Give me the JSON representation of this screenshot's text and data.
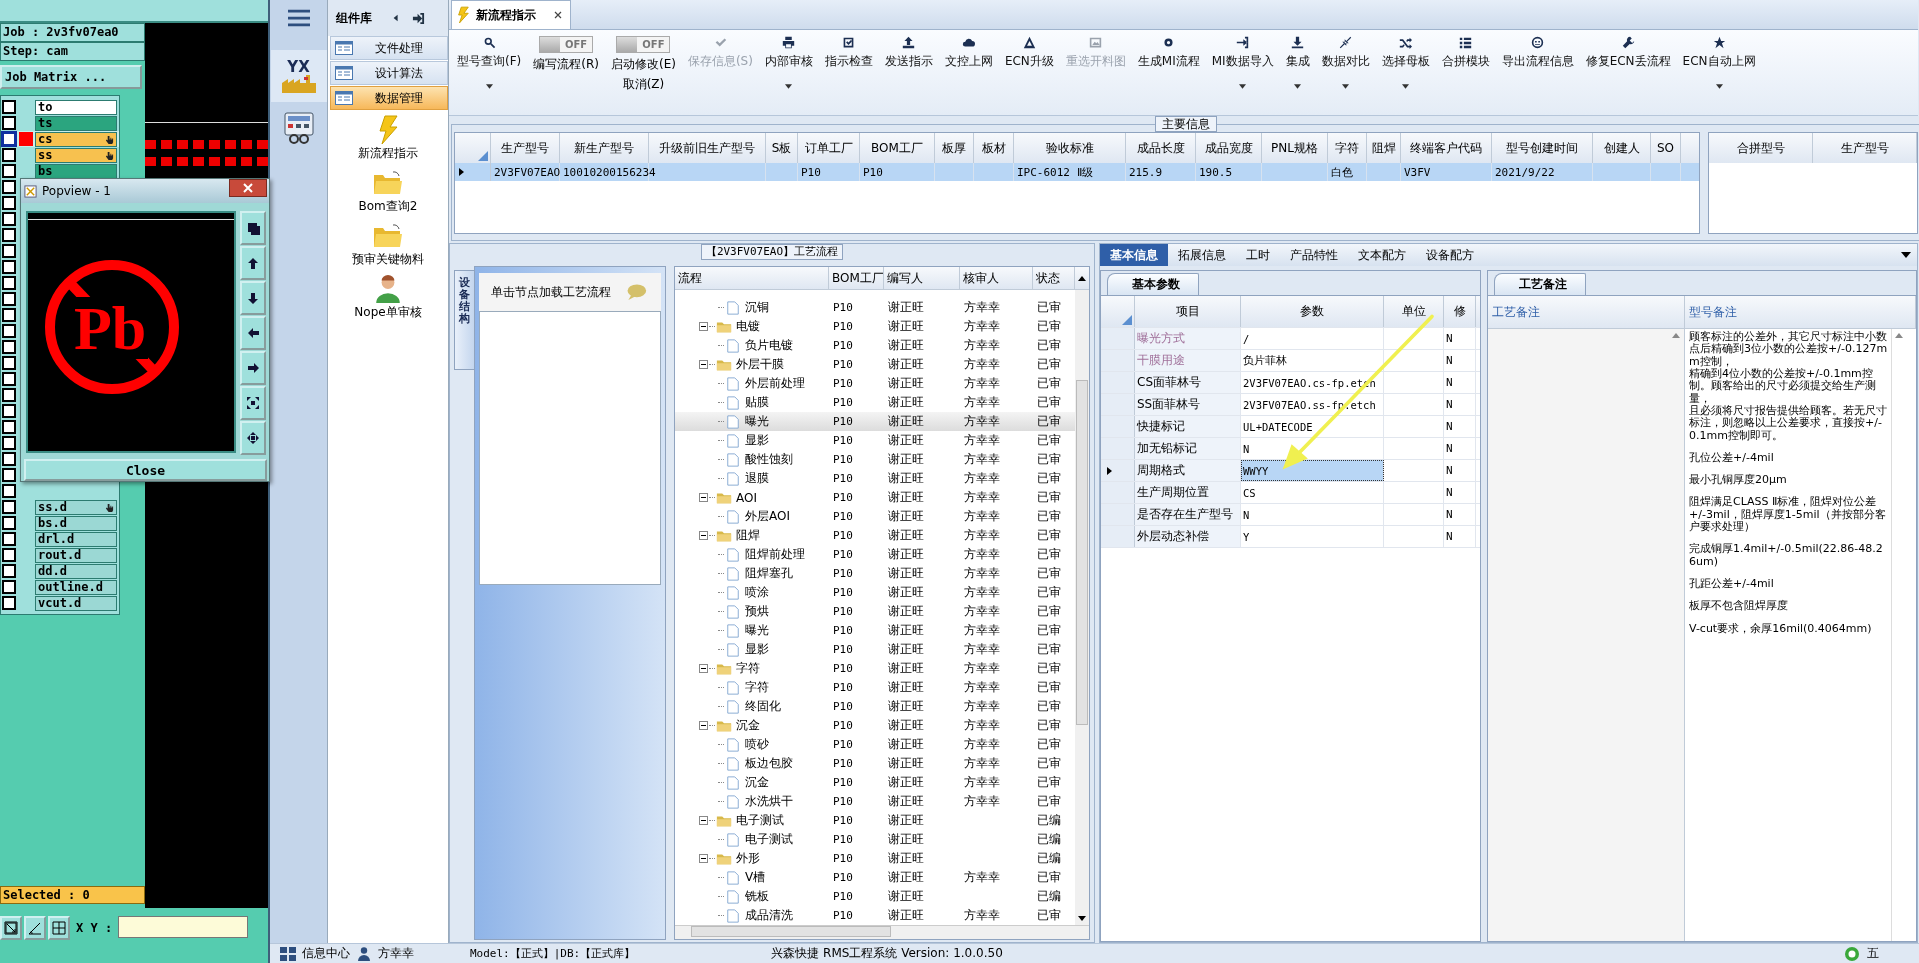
{
  "cam": {
    "job": "Job : 2v3fv07ea0",
    "step": "Step: cam",
    "matrix_button": "Job Matrix ...",
    "layers_top": [
      {
        "name": "to",
        "color": "#ffffff",
        "checked": false,
        "selected": false,
        "pinned": false
      },
      {
        "name": "ts",
        "color": "#2ba57f",
        "checked": false,
        "selected": false,
        "pinned": false
      },
      {
        "name": "cs",
        "color": "#f7c14f",
        "checked": false,
        "selected": true,
        "pinned": true
      },
      {
        "name": "ss",
        "color": "#f7c14f",
        "checked": false,
        "selected": false,
        "pinned": true
      },
      {
        "name": "bs",
        "color": "#2ba57f",
        "checked": false,
        "selected": false,
        "pinned": false
      }
    ],
    "layers_hidden": [
      {
        "checked": false
      },
      {
        "checked": false
      },
      {
        "checked": false
      },
      {
        "checked": false
      },
      {
        "checked": false
      },
      {
        "checked": false
      },
      {
        "checked": false
      },
      {
        "checked": false
      },
      {
        "checked": false
      },
      {
        "checked": false
      },
      {
        "checked": false
      },
      {
        "checked": false
      },
      {
        "checked": false
      },
      {
        "checked": false
      },
      {
        "checked": false
      },
      {
        "checked": false
      },
      {
        "checked": false
      },
      {
        "checked": false
      },
      {
        "checked": false
      },
      {
        "checked": false
      }
    ],
    "layers_bottom": [
      {
        "name": "ss.d",
        "color": "#9bd8d4",
        "checked": false,
        "selected": false,
        "pinned": true
      },
      {
        "name": "bs.d",
        "color": "#9bd8d4",
        "checked": false,
        "selected": false,
        "pinned": false
      },
      {
        "name": "drl.d",
        "color": "#9bd8d4",
        "checked": false,
        "selected": false,
        "pinned": false
      },
      {
        "name": "rout.d",
        "color": "#9bd8d4",
        "checked": false,
        "selected": false,
        "pinned": false
      },
      {
        "name": "dd.d",
        "color": "#9bd8d4",
        "checked": false,
        "selected": false,
        "pinned": false
      },
      {
        "name": "outline.d",
        "color": "#9bd8d4",
        "checked": false,
        "selected": false,
        "pinned": false
      },
      {
        "name": "vcut.d",
        "color": "#9bd8d4",
        "checked": false,
        "selected": false,
        "pinned": false
      }
    ],
    "selected_count": "Selected : 0",
    "xy_label": "X Y :"
  },
  "popview": {
    "title": "Popview - 1",
    "symbol": "Pb",
    "close_button": "Close"
  },
  "nav": {
    "logo_text": "YX",
    "library_title": "组件库",
    "categories": [
      {
        "label": "文件处理",
        "selected": false
      },
      {
        "label": "设计算法",
        "selected": false
      },
      {
        "label": "数据管理",
        "selected": true
      }
    ],
    "tools": [
      {
        "label": "新流程指示",
        "kind": "lightning"
      },
      {
        "label": "Bom查询2",
        "kind": "folder"
      },
      {
        "label": "预审关键物料",
        "kind": "folder"
      },
      {
        "label": "Nope单审核",
        "kind": "user"
      }
    ]
  },
  "document_tab": {
    "label": "新流程指示",
    "selected": true
  },
  "toolbar": [
    {
      "kind": "button",
      "label": "型号查询(F)",
      "disabled": false,
      "dropdown": true
    },
    {
      "kind": "toggle",
      "label": "编写流程(R)",
      "switch": "OFF",
      "on": false
    },
    {
      "kind": "toggle",
      "label": "启动修改(E)",
      "sub_label": "取消(Z)",
      "switch": "OFF",
      "on": false
    },
    {
      "kind": "button",
      "label": "保存信息(S)",
      "disabled": true,
      "dropdown": false
    },
    {
      "kind": "button",
      "label": "内部审核",
      "disabled": false,
      "dropdown": true
    },
    {
      "kind": "button",
      "label": "指示检查",
      "disabled": false,
      "dropdown": false
    },
    {
      "kind": "button",
      "label": "发送指示",
      "disabled": false,
      "dropdown": false
    },
    {
      "kind": "button",
      "label": "文控上网",
      "disabled": false,
      "dropdown": false
    },
    {
      "kind": "button",
      "label": "ECN升级",
      "disabled": false,
      "dropdown": false
    },
    {
      "kind": "button",
      "label": "重选开料图",
      "disabled": true,
      "dropdown": false
    },
    {
      "kind": "button",
      "label": "生成MI流程",
      "disabled": false,
      "dropdown": false
    },
    {
      "kind": "button",
      "label": "MI数据导入",
      "disabled": false,
      "dropdown": true
    },
    {
      "kind": "button",
      "label": "集成",
      "disabled": false,
      "dropdown": true
    },
    {
      "kind": "button",
      "label": "数据对比",
      "disabled": false,
      "dropdown": true
    },
    {
      "kind": "button",
      "label": "选择母板",
      "disabled": false,
      "dropdown": true
    },
    {
      "kind": "button",
      "label": "合拼模块",
      "disabled": false,
      "dropdown": false
    },
    {
      "kind": "button",
      "label": "导出流程信息",
      "disabled": false,
      "dropdown": false
    },
    {
      "kind": "button",
      "label": "修复ECN丢流程",
      "disabled": false,
      "dropdown": false
    },
    {
      "kind": "button",
      "label": "ECN自动上网",
      "disabled": false,
      "dropdown": true
    }
  ],
  "main_info": {
    "title": "主要信息",
    "columns": [
      "生产型号",
      "新生产型号",
      "升级前旧生产型号",
      "S板",
      "订单工厂",
      "BOM工厂",
      "板厚",
      "板材",
      "验收标准",
      "成品长度",
      "成品宽度",
      "PNL规格",
      "字符",
      "阻焊",
      "终端客户代码",
      "型号创建时间",
      "创建人",
      "SO"
    ],
    "rows": [
      {
        "selected": true,
        "cells": [
          "2V3FV07EAO",
          "10010200156234",
          null,
          null,
          "P10",
          "P10",
          null,
          null,
          "IPC-6012 Ⅱ级",
          "215.9",
          "190.5",
          null,
          "白色",
          null,
          "V3FV",
          "2021/9/22",
          null,
          null
        ]
      }
    ],
    "side_columns": [
      "合拼型号",
      "生产型号"
    ]
  },
  "flow": {
    "title": "【2V3FV07EAO】工艺流程",
    "side_tab": "设备结构",
    "hint": "单击节点加载工艺流程",
    "columns": [
      "流程",
      "BOM工厂",
      "编写人",
      "核审人",
      "状态"
    ],
    "rows": [
      {
        "kind": "step",
        "name": "沉铜",
        "bom": "P10",
        "writer": "谢正旺",
        "reviewer": "方幸幸",
        "status": "已审",
        "selected": false
      },
      {
        "kind": "folder",
        "name": "电镀",
        "bom": "P10",
        "writer": "谢正旺",
        "reviewer": "方幸幸",
        "status": "已审",
        "selected": false,
        "children": [
          {
            "kind": "step",
            "name": "负片电镀",
            "bom": "P10",
            "writer": "谢正旺",
            "reviewer": "方幸幸",
            "status": "已审",
            "selected": false
          }
        ]
      },
      {
        "kind": "folder",
        "name": "外层干膜",
        "bom": "P10",
        "writer": "谢正旺",
        "reviewer": "方幸幸",
        "status": "已审",
        "selected": false,
        "children": [
          {
            "kind": "step",
            "name": "外层前处理",
            "bom": "P10",
            "writer": "谢正旺",
            "reviewer": "方幸幸",
            "status": "已审",
            "selected": false
          },
          {
            "kind": "step",
            "name": "贴膜",
            "bom": "P10",
            "writer": "谢正旺",
            "reviewer": "方幸幸",
            "status": "已审",
            "selected": false
          },
          {
            "kind": "step",
            "name": "曝光",
            "bom": "P10",
            "writer": "谢正旺",
            "reviewer": "方幸幸",
            "status": "已审",
            "selected": true
          },
          {
            "kind": "step",
            "name": "显影",
            "bom": "P10",
            "writer": "谢正旺",
            "reviewer": "方幸幸",
            "status": "已审",
            "selected": false
          },
          {
            "kind": "step",
            "name": "酸性蚀刻",
            "bom": "P10",
            "writer": "谢正旺",
            "reviewer": "方幸幸",
            "status": "已审",
            "selected": false
          },
          {
            "kind": "step",
            "name": "退膜",
            "bom": "P10",
            "writer": "谢正旺",
            "reviewer": "方幸幸",
            "status": "已审",
            "selected": false
          }
        ]
      },
      {
        "kind": "folder",
        "name": "AOI",
        "bom": "P10",
        "writer": "谢正旺",
        "reviewer": "方幸幸",
        "status": "已审",
        "selected": false,
        "children": [
          {
            "kind": "step",
            "name": "外层AOI",
            "bom": "P10",
            "writer": "谢正旺",
            "reviewer": "方幸幸",
            "status": "已审",
            "selected": false
          }
        ]
      },
      {
        "kind": "folder",
        "name": "阻焊",
        "bom": "P10",
        "writer": "谢正旺",
        "reviewer": "方幸幸",
        "status": "已审",
        "selected": false,
        "children": [
          {
            "kind": "step",
            "name": "阻焊前处理",
            "bom": "P10",
            "writer": "谢正旺",
            "reviewer": "方幸幸",
            "status": "已审",
            "selected": false
          },
          {
            "kind": "step",
            "name": "阻焊塞孔",
            "bom": "P10",
            "writer": "谢正旺",
            "reviewer": "方幸幸",
            "status": "已审",
            "selected": false
          },
          {
            "kind": "step",
            "name": "喷涂",
            "bom": "P10",
            "writer": "谢正旺",
            "reviewer": "方幸幸",
            "status": "已审",
            "selected": false
          },
          {
            "kind": "step",
            "name": "预烘",
            "bom": "P10",
            "writer": "谢正旺",
            "reviewer": "方幸幸",
            "status": "已审",
            "selected": false
          },
          {
            "kind": "step",
            "name": "曝光",
            "bom": "P10",
            "writer": "谢正旺",
            "reviewer": "方幸幸",
            "status": "已审",
            "selected": false
          },
          {
            "kind": "step",
            "name": "显影",
            "bom": "P10",
            "writer": "谢正旺",
            "reviewer": "方幸幸",
            "status": "已审",
            "selected": false
          }
        ]
      },
      {
        "kind": "folder",
        "name": "字符",
        "bom": "P10",
        "writer": "谢正旺",
        "reviewer": "方幸幸",
        "status": "已审",
        "selected": false,
        "children": [
          {
            "kind": "step",
            "name": "字符",
            "bom": "P10",
            "writer": "谢正旺",
            "reviewer": "方幸幸",
            "status": "已审",
            "selected": false
          },
          {
            "kind": "step",
            "name": "终固化",
            "bom": "P10",
            "writer": "谢正旺",
            "reviewer": "方幸幸",
            "status": "已审",
            "selected": false
          }
        ]
      },
      {
        "kind": "folder",
        "name": "沉金",
        "bom": "P10",
        "writer": "谢正旺",
        "reviewer": "方幸幸",
        "status": "已审",
        "selected": false,
        "children": [
          {
            "kind": "step",
            "name": "喷砂",
            "bom": "P10",
            "writer": "谢正旺",
            "reviewer": "方幸幸",
            "status": "已审",
            "selected": false
          },
          {
            "kind": "step",
            "name": "板边包胶",
            "bom": "P10",
            "writer": "谢正旺",
            "reviewer": "方幸幸",
            "status": "已审",
            "selected": false
          },
          {
            "kind": "step",
            "name": "沉金",
            "bom": "P10",
            "writer": "谢正旺",
            "reviewer": "方幸幸",
            "status": "已审",
            "selected": false
          },
          {
            "kind": "step",
            "name": "水洗烘干",
            "bom": "P10",
            "writer": "谢正旺",
            "reviewer": "方幸幸",
            "status": "已审",
            "selected": false
          }
        ]
      },
      {
        "kind": "folder",
        "name": "电子测试",
        "bom": "P10",
        "writer": "谢正旺",
        "status": "已编",
        "selected": false,
        "children": [
          {
            "kind": "step",
            "name": "电子测试",
            "bom": "P10",
            "writer": "谢正旺",
            "status": "已编",
            "selected": false
          }
        ]
      },
      {
        "kind": "folder",
        "name": "外形",
        "bom": "P10",
        "writer": "谢正旺",
        "status": "已编",
        "selected": false,
        "children": [
          {
            "kind": "step",
            "name": "V槽",
            "bom": "P10",
            "writer": "谢正旺",
            "reviewer": "方幸幸",
            "status": "已审",
            "selected": false
          },
          {
            "kind": "step",
            "name": "铣板",
            "bom": "P10",
            "writer": "谢正旺",
            "status": "已编",
            "selected": false
          },
          {
            "kind": "step",
            "name": "成品清洗",
            "bom": "P10",
            "writer": "谢正旺",
            "reviewer": "方幸幸",
            "status": "已审",
            "selected": false
          }
        ]
      }
    ]
  },
  "details": {
    "tabs": [
      {
        "label": "基本信息",
        "selected": true
      },
      {
        "label": "拓展信息",
        "selected": false
      },
      {
        "label": "工时",
        "selected": false
      },
      {
        "label": "产品特性",
        "selected": false
      },
      {
        "label": "文本配方",
        "selected": false
      },
      {
        "label": "设备配方",
        "selected": false
      }
    ],
    "params_tab": "基本参数",
    "param_columns": [
      "项目",
      "参数",
      "单位",
      "修"
    ],
    "params": [
      {
        "item": "曝光方式",
        "value": "/",
        "modified": "N",
        "emphasis": true,
        "selected": false
      },
      {
        "item": "干膜用途",
        "value": "负片菲林",
        "modified": "N",
        "emphasis": true,
        "selected": false
      },
      {
        "item": "CS面菲林号",
        "value": "2V3FV07EAO.cs-fp.etch",
        "modified": "N",
        "emphasis": false,
        "selected": false
      },
      {
        "item": "SS面菲林号",
        "value": "2V3FV07EAO.ss-fp.etch",
        "modified": "N",
        "emphasis": false,
        "selected": false
      },
      {
        "item": "快捷标记",
        "value": "UL+DATECODE",
        "modified": "N",
        "emphasis": false,
        "selected": false
      },
      {
        "item": "加无铅标记",
        "value": "N",
        "modified": "N",
        "emphasis": false,
        "selected": false
      },
      {
        "item": "周期格式",
        "value": "WWYY",
        "modified": "N",
        "emphasis": false,
        "selected": true
      },
      {
        "item": "生产周期位置",
        "value": "CS",
        "modified": "N",
        "emphasis": false,
        "selected": false
      },
      {
        "item": "是否存在生产型号",
        "value": "N",
        "modified": "N",
        "emphasis": false,
        "selected": false
      },
      {
        "item": "外层动态补偿",
        "value": "Y",
        "modified": "N",
        "emphasis": false,
        "selected": false
      }
    ],
    "notes_tab": "工艺备注",
    "note_columns": [
      "工艺备注",
      "型号备注"
    ],
    "model_notes": [
      "顾客标注的公差外，其它尺寸标注中小数点后精确到3位小数的公差按+/-0.127mm控制，",
      "精确到4位小数的公差按+/-0.1mm控制。顾客给出的尺寸必须提交给生产测量，",
      "且必须将尺寸报告提供给顾客。若无尺寸标注，则忽略以上公差要求，直接按+/-0.1mm控制即可。",
      "孔位公差+/-4mil",
      "最小孔铜厚度20μm",
      "阻焊满足CLASS Ⅱ标准，阻焊对位公差+/-3mil，阻焊厚度1-5mil（并按部分客户要求处理）",
      "完成铜厚1.4mil+/-0.5mil(22.86-48.26um)",
      "孔距公差+/-4mil",
      "板厚不包含阻焊厚度",
      "V-cut要求，余厚16mil(0.4064mm)"
    ]
  },
  "status_bar": {
    "info_center": "信息中心",
    "user": "方幸幸",
    "environment": "Model:【正式】|DB:【正式库】",
    "product": "兴森快捷 RMS工程系统 Version: 1.0.0.50",
    "ime": "五"
  }
}
